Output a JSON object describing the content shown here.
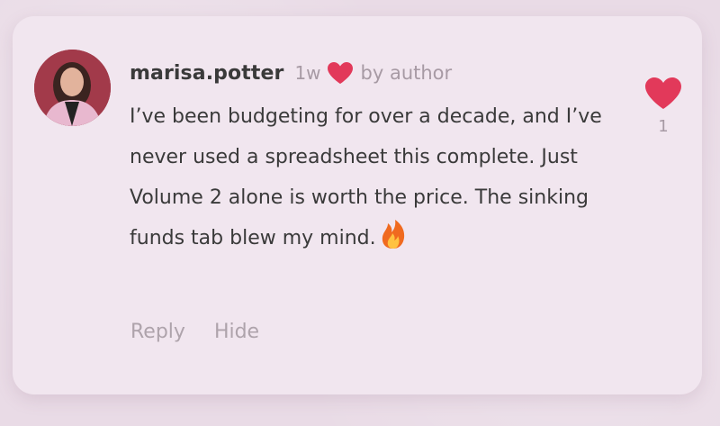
{
  "comment": {
    "username": "marisa.potter",
    "time_ago": "1w",
    "liked_by_author_icon": "heart-icon",
    "liked_by_label": "by author",
    "text": "I’ve been budgeting for over a decade, and I’ve never used a spreadsheet this complete. Just Volume 2 alone is worth the price. The sinking funds tab blew my mind.",
    "emoji_icon": "fire-icon",
    "like_icon": "heart-icon",
    "like_count": "1",
    "actions": {
      "reply_label": "Reply",
      "hide_label": "Hide"
    }
  },
  "colors": {
    "heart": "#e2395a",
    "text": "#3a3a3a",
    "muted": "#a79aa4",
    "card_bg": "#f1e6ef"
  }
}
